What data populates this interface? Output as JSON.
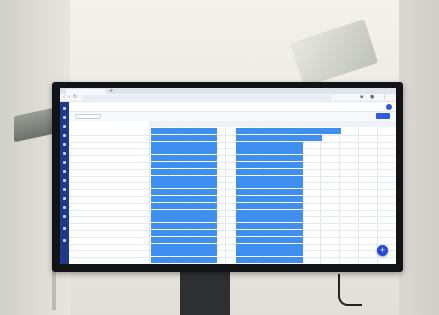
{
  "browser": {
    "tab_title": "",
    "url": ""
  },
  "app": {
    "brand": "",
    "user_name": "",
    "action_label": ""
  },
  "toolbar": {
    "filter_label": ""
  },
  "grid": {
    "column_headers": [
      "",
      "",
      "",
      "",
      "",
      "",
      "",
      "",
      "",
      "",
      "",
      "",
      ""
    ],
    "rows": [
      {
        "label": ""
      },
      {
        "label": ""
      },
      {
        "label": ""
      },
      {
        "label": ""
      },
      {
        "label": ""
      },
      {
        "label": ""
      },
      {
        "label": ""
      },
      {
        "label": ""
      },
      {
        "label": ""
      },
      {
        "label": ""
      },
      {
        "label": ""
      },
      {
        "label": ""
      },
      {
        "label": ""
      },
      {
        "label": ""
      },
      {
        "label": ""
      },
      {
        "label": ""
      },
      {
        "label": ""
      },
      {
        "label": ""
      },
      {
        "label": ""
      },
      {
        "label": ""
      }
    ]
  },
  "colors": {
    "bar": "#3f8ff0",
    "sidebar": "#1e3a8a",
    "fab": "#2546d8"
  }
}
